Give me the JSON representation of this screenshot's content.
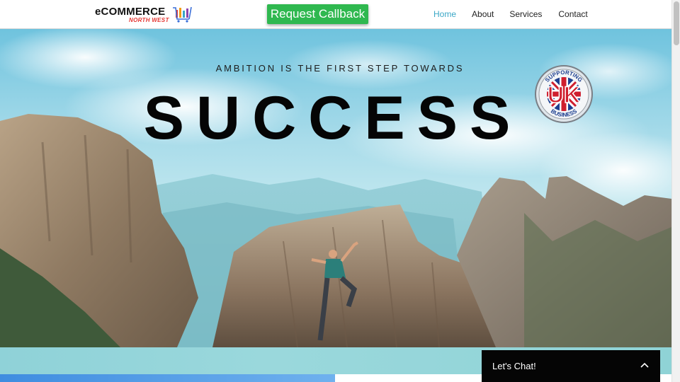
{
  "header": {
    "logo": {
      "main": "eCOMMERCE",
      "sub": "NORTH WEST",
      "icon": "shopping-cart-bars-icon"
    },
    "cta_label": "Request Callback",
    "nav": [
      {
        "label": "Home",
        "active": true
      },
      {
        "label": "About",
        "active": false
      },
      {
        "label": "Services",
        "active": false
      },
      {
        "label": "Contact",
        "active": false
      }
    ]
  },
  "hero": {
    "tagline": "AMBITION IS THE FIRST STEP TOWARDS",
    "headline": "SUCCESS",
    "badge": {
      "top_text": "SUPPORTING",
      "center_text": "UK",
      "bottom_text": "BUSINESS",
      "icon": "union-jack-badge"
    }
  },
  "chat": {
    "label": "Let's Chat!",
    "icon": "chevron-up-icon"
  },
  "colors": {
    "accent_nav": "#3aa7c6",
    "cta_green": "#2fb84f",
    "logo_red": "#e53935",
    "chat_bg": "#050505"
  }
}
